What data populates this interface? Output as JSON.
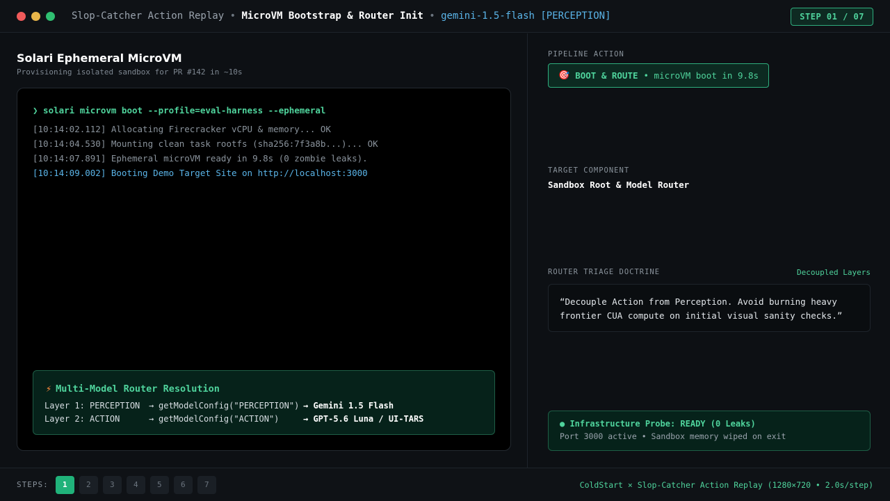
{
  "titlebar": {
    "app": "Slop-Catcher Action Replay",
    "sep": "•",
    "scenario": "MicroVM Bootstrap & Router Init",
    "model": "gemini-1.5-flash [PERCEPTION]",
    "step_badge": "STEP 01 / 07"
  },
  "left": {
    "title": "Solari Ephemeral MicroVM",
    "subtitle": "Provisioning isolated sandbox for PR #142 in ~10s",
    "terminal": {
      "command": "❯ solari microvm boot --profile=eval-harness --ephemeral",
      "logs": [
        "[10:14:02.112] Allocating Firecracker vCPU & memory... OK",
        "[10:14:04.530] Mounting clean task rootfs (sha256:7f3a8b...)... OK",
        "[10:14:07.891] Ephemeral microVM ready in 9.8s (0 zombie leaks).",
        "[10:14:09.002] Booting Demo Target Site on http://localhost:3000"
      ]
    },
    "router": {
      "icon": "⚡",
      "title": "Multi-Model Router Resolution",
      "rows": [
        {
          "layer": "Layer 1: PERCEPTION",
          "arrow": "→",
          "call": "getModelConfig(\"PERCEPTION\")",
          "result": "→ Gemini 1.5 Flash"
        },
        {
          "layer": "Layer 2: ACTION",
          "arrow": "→",
          "call": "getModelConfig(\"ACTION\")",
          "result": "→ GPT-5.6 Luna / UI-TARS"
        }
      ]
    }
  },
  "right": {
    "pipeline_label": "PIPELINE ACTION",
    "action_icon": "🎯",
    "action_name": "BOOT & ROUTE",
    "action_detail": "• microVM boot in 9.8s",
    "target_label": "TARGET COMPONENT",
    "target_value": "Sandbox Root & Model Router",
    "doctrine_label": "ROUTER TRIAGE DOCTRINE",
    "doctrine_tag": "Decoupled Layers",
    "doctrine_text": "“Decouple Action from Perception. Avoid burning heavy frontier CUA compute on initial visual sanity checks.”",
    "probe_title": "● Infrastructure Probe: READY (0 Leaks)",
    "probe_detail": "Port 3000 active • Sandbox memory wiped on exit"
  },
  "footer": {
    "steps_label": "STEPS:",
    "steps": [
      "1",
      "2",
      "3",
      "4",
      "5",
      "6",
      "7"
    ],
    "active_step": "1",
    "caption": "ColdStart × Slop-Catcher Action Replay (1280×720 • 2.0s/step)"
  },
  "colors": {
    "accent_green": "#4fd39c",
    "accent_blue": "#5ab4e8",
    "background": "#0d1014"
  }
}
